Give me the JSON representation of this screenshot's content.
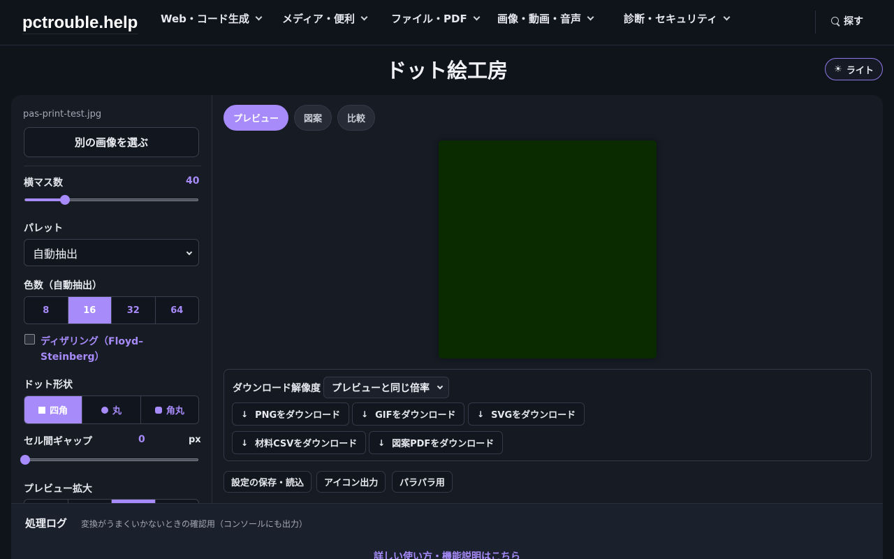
{
  "header": {
    "logo": "pctrouble.help",
    "nav": [
      {
        "label": "Web・コード生成"
      },
      {
        "label": "メディア・便利"
      },
      {
        "label": "ファイル・PDF"
      },
      {
        "label": "画像・動画・音声"
      },
      {
        "label": "診断・セキュリティ"
      }
    ],
    "search_label": "探す",
    "search_icon": "search-icon"
  },
  "page": {
    "title": "ドット絵工房",
    "theme_button": {
      "icon": "☀",
      "label": "ライト"
    }
  },
  "sidebar": {
    "filename": "pas-print-test.jpg",
    "choose_image_label": "別の画像を選ぶ",
    "columns": {
      "label": "横マス数",
      "value": "40",
      "fraction": 0.23
    },
    "palette": {
      "label": "パレット",
      "selected": "自動抽出"
    },
    "color_count": {
      "label": "色数（自動抽出）",
      "options": [
        "8",
        "16",
        "32",
        "64"
      ],
      "active": "16"
    },
    "dithering": {
      "label": "ディザリング（Floyd–Steinberg）",
      "checked": false
    },
    "dot_shape": {
      "label": "ドット形状",
      "options": [
        "四角",
        "丸",
        "角丸"
      ],
      "active": "四角"
    },
    "cell_gap": {
      "label": "セル間ギャップ",
      "value": "0",
      "unit": "px",
      "fraction": 0.0
    },
    "preview_zoom": {
      "label": "プレビュー拡大"
    }
  },
  "main": {
    "tabs": [
      {
        "label": "プレビュー",
        "active": true
      },
      {
        "label": "図案",
        "active": false
      },
      {
        "label": "比較",
        "active": false
      }
    ],
    "preview_color": "#0a2b00",
    "download": {
      "resolution_label": "ダウンロード解像度",
      "resolution_selected": "プレビューと同じ倍率",
      "buttons": [
        "PNGをダウンロード",
        "GIFをダウンロード",
        "SVGをダウンロード",
        "材料CSVをダウンロード",
        "図案PDFをダウンロード"
      ],
      "arrow": "↓"
    },
    "utility_buttons": [
      "設定の保存・読込",
      "アイコン出力",
      "パラパラ用"
    ]
  },
  "log": {
    "title": "処理ログ",
    "description": "変換がうまくいかないときの確認用（コンソールにも出力）"
  },
  "footer": {
    "help_link": "詳しい使い方・機能説明はこちら"
  },
  "colors": {
    "accent": "#a78bfa",
    "background": "#0f131a",
    "panel": "#161b24"
  }
}
